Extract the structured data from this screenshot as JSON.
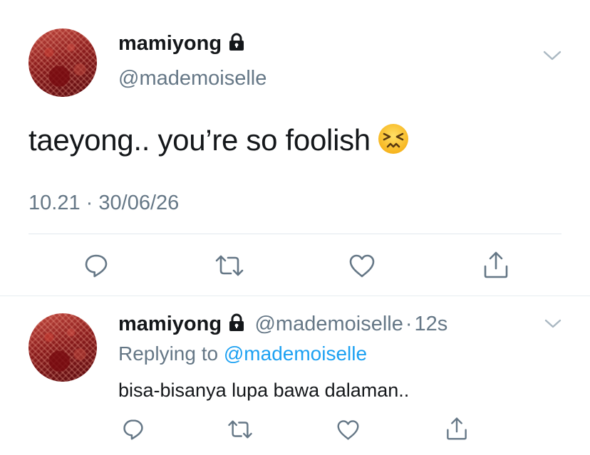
{
  "main_tweet": {
    "display_name": "mamiyong",
    "handle": "@mademoiselle",
    "text": "taeyong.. you’re so foolish",
    "emoji_name": "persevering-face-icon",
    "time": "10.21",
    "separator": "·",
    "date": "30/06/26"
  },
  "reply_tweet": {
    "display_name": "mamiyong",
    "handle": "@mademoiselle",
    "separator": "·",
    "age": "12s",
    "replying_prefix": "Replying to",
    "replying_handle": "@mademoiselle",
    "text": "bisa-bisanya lupa bawa dalaman.."
  },
  "actions": [
    "reply-icon",
    "retweet-icon",
    "like-icon",
    "share-icon"
  ],
  "colors": {
    "text": "#14171a",
    "secondary": "#657786",
    "link": "#1da1f2",
    "divider": "#e1e8ed",
    "icon": "#657786"
  }
}
